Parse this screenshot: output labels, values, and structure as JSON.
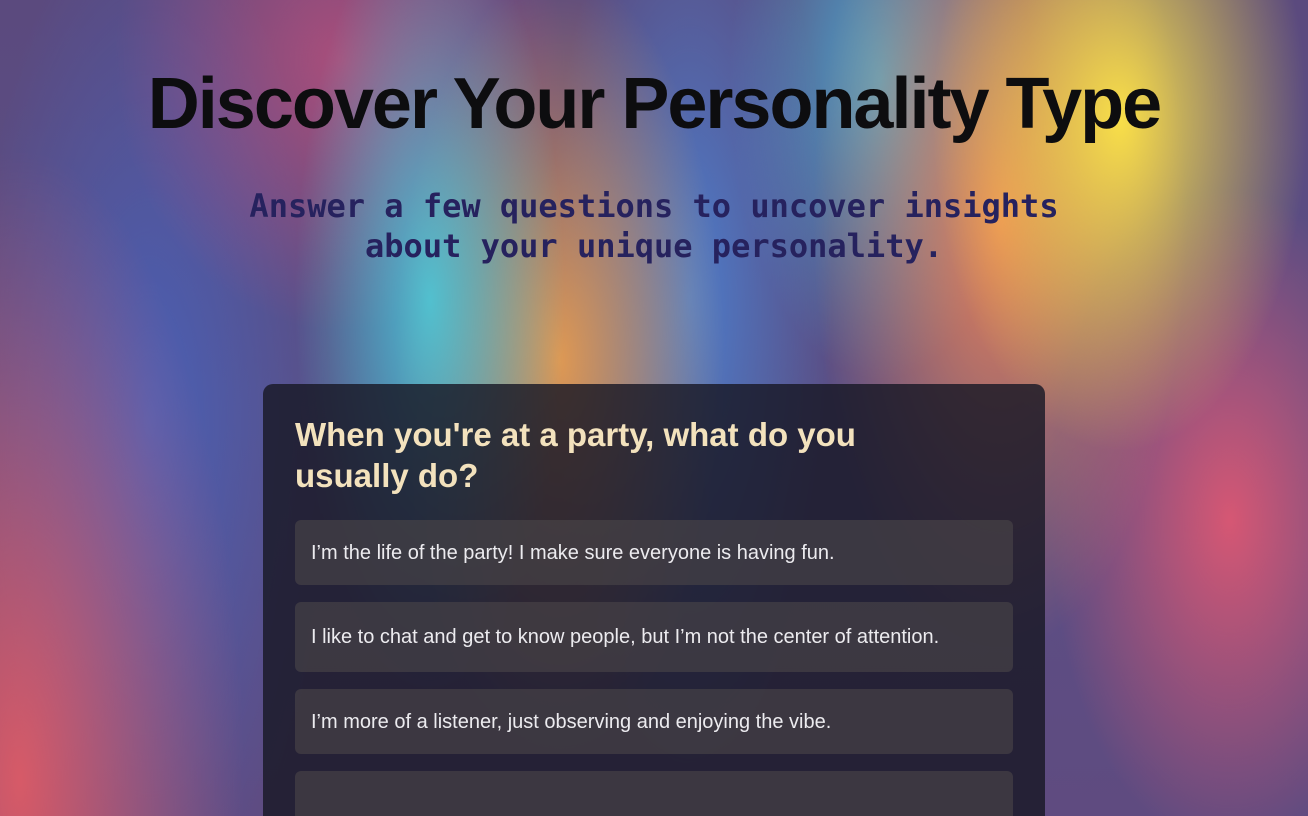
{
  "header": {
    "title": "Discover Your Personality Type",
    "subtitle": "Answer a few questions to uncover insights about your unique personality."
  },
  "quiz": {
    "question": "When you're at a party, what do you usually do?",
    "options": [
      {
        "label": "I’m the life of the party! I make sure everyone is having fun."
      },
      {
        "label": "I like to chat and get to know people, but I’m not the center of attention."
      },
      {
        "label": "I’m more of a listener, just observing and enjoying the vibe."
      },
      {
        "label": ""
      }
    ]
  },
  "colors": {
    "title": "#0d0d0f",
    "subtitle": "#26225e",
    "question": "#f3e2bd",
    "card": "#191926",
    "option_text": "#ecebef"
  }
}
